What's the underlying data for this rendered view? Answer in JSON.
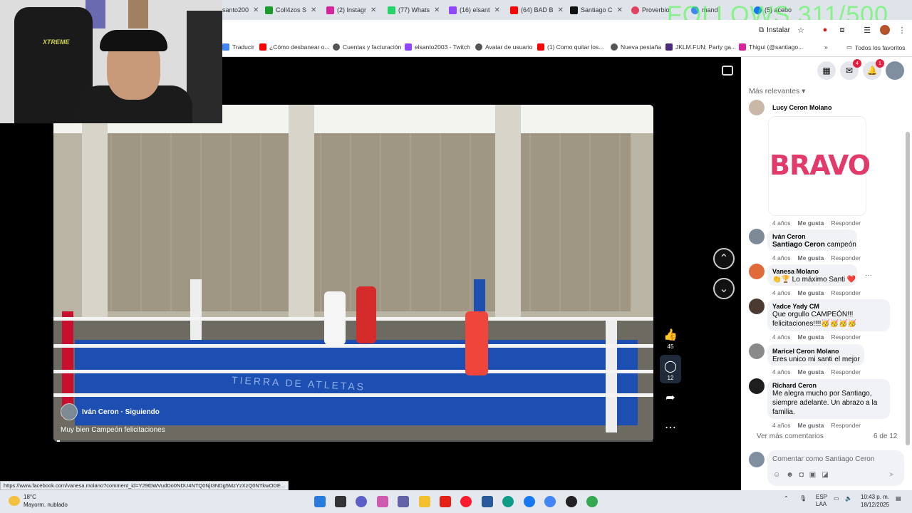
{
  "browser": {
    "tabs": [
      {
        "label": "santo200",
        "color": "#9147ff"
      },
      {
        "label": "Coll4zos S",
        "color": "#1c9b2a"
      },
      {
        "label": "(2) Instagr",
        "color": "#d6249f"
      },
      {
        "label": "(77) Whats",
        "color": "#25d366"
      },
      {
        "label": "(16) elsant",
        "color": "#9147ff"
      },
      {
        "label": "(64) BAD B",
        "color": "#ff0000"
      },
      {
        "label": "Santiago C",
        "color": "#111111"
      },
      {
        "label": "Proverbio",
        "color": "#e4405f"
      },
      {
        "label": "mand",
        "color": "#4285f4"
      },
      {
        "label": "(5) acebo",
        "color": "#1877f2"
      }
    ],
    "overlay_text": "FOLLOWS 311/500",
    "install_label": "Instalar",
    "bookmarks": [
      {
        "label": "Traducir",
        "color": "#4285f4"
      },
      {
        "label": "¿Cómo desbanear o...",
        "color": "#ff0000"
      },
      {
        "label": "Cuentas y facturación",
        "color": "#555555"
      },
      {
        "label": "elsanto2003 - Twitch",
        "color": "#9147ff"
      },
      {
        "label": "Avatar de usuario",
        "color": "#555555"
      },
      {
        "label": "(1) Como quitar los...",
        "color": "#ff0000"
      },
      {
        "label": "Nueva pestaña",
        "color": "#555555"
      },
      {
        "label": "JKLM.FUN: Party ga...",
        "color": "#4a2a7a"
      },
      {
        "label": "Thigui (@santiago...",
        "color": "#d6249f"
      }
    ],
    "all_favorites_label": "Todos los favoritos",
    "status_url": "https://www.facebook.com/vanesa.molano?comment_id=Y29tbWVudDo0NDU4NTQ0NjI3NDg5MzYzXzQ0NTkwODE..."
  },
  "webcam": {
    "chair_text": "XTREME"
  },
  "video": {
    "author": "Iván Ceron · Siguiendo",
    "caption": "Muy bien Campeón felicitaciones",
    "ring_text": "TIERRA DE ATLETAS",
    "likes": "45",
    "comments_count": "12",
    "progress": 0.005
  },
  "panel": {
    "badges": {
      "messenger": "4",
      "notifications": "1"
    },
    "sort_label": "Más relevantes",
    "sticker_text": "BRAVO",
    "comments": [
      {
        "name": "Lucy Ceron Molano",
        "text": "",
        "time": "4 años",
        "like": "Me gusta",
        "reply": "Responder"
      },
      {
        "name": "Iván Ceron",
        "mention": "Santiago Ceron",
        "text": "campeón",
        "time": "4 años",
        "like": "Me gusta",
        "reply": "Responder"
      },
      {
        "name": "Vanesa Molano",
        "text": "👏🏆 Lo máximo Santi ❤️",
        "time": "4 años",
        "like": "Me gusta",
        "reply": "Responder"
      },
      {
        "name": "Yadce Yady CM",
        "text": "Que orgullo CAMPEÓN!!! felicitaciones!!!!🥳🥳🥳🥳",
        "time": "4 años",
        "like": "Me gusta",
        "reply": "Responder"
      },
      {
        "name": "Maricel Ceron Molano",
        "text": "Eres unico mi santi el mejor",
        "time": "4 años",
        "like": "Me gusta",
        "reply": "Responder"
      },
      {
        "name": "Richard Ceron",
        "text": "Me alegra mucho por Santiago, siempre adelante. Un abrazo a la familia.",
        "time": "4 años",
        "like": "Me gusta",
        "reply": "Responder"
      }
    ],
    "more_comments": "Ver más comentarios",
    "count_label": "6 de 12",
    "compose_placeholder": "Comentar como Santiago Ceron"
  },
  "taskbar": {
    "temp": "18°C",
    "weather": "Mayorm. nublado",
    "lang_1": "ESP",
    "lang_2": "LAA",
    "time": "10:43 p. m.",
    "date": "18/12/2025"
  }
}
